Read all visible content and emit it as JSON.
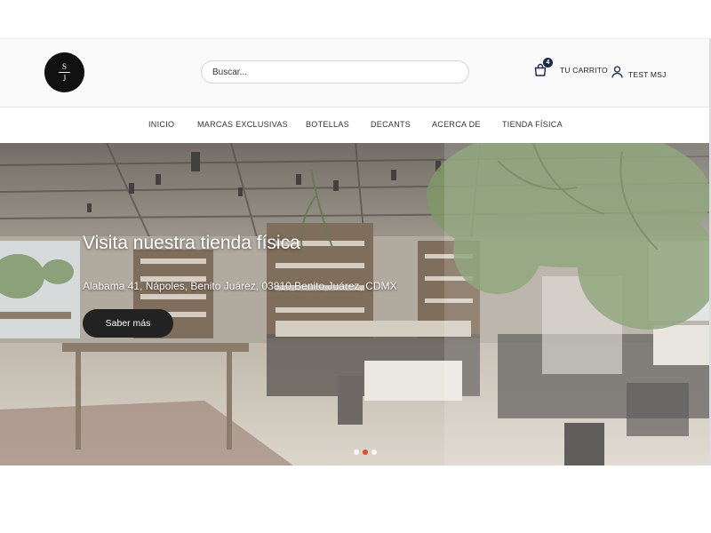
{
  "logo": {
    "top_letter": "S",
    "bottom_letter": "J"
  },
  "search": {
    "placeholder": "Buscar..."
  },
  "cart": {
    "count": "4",
    "label": "TU CARRITO",
    "icon": "shopping-bag-icon"
  },
  "account": {
    "label": "TEST MSJ",
    "icon": "user-icon"
  },
  "nav": {
    "items": [
      {
        "label": "INICIO"
      },
      {
        "label": "MARCAS EXCLUSIVAS"
      },
      {
        "label": "BOTELLAS"
      },
      {
        "label": "DECANTS"
      },
      {
        "label": "ACERCA DE"
      },
      {
        "label": "TIENDA FÍSICA"
      }
    ]
  },
  "hero": {
    "title": "Visita nuestra tienda física",
    "subtitle": "Alabama 41, Nápoles, Benito Juárez, 03810 Benito Juárez, CDMX",
    "button_label": "Saber más",
    "slides": 3,
    "active_slide": 2
  },
  "colors": {
    "badge": "#1c2a4a",
    "button": "#222222",
    "active_dot": "#e2472f"
  }
}
